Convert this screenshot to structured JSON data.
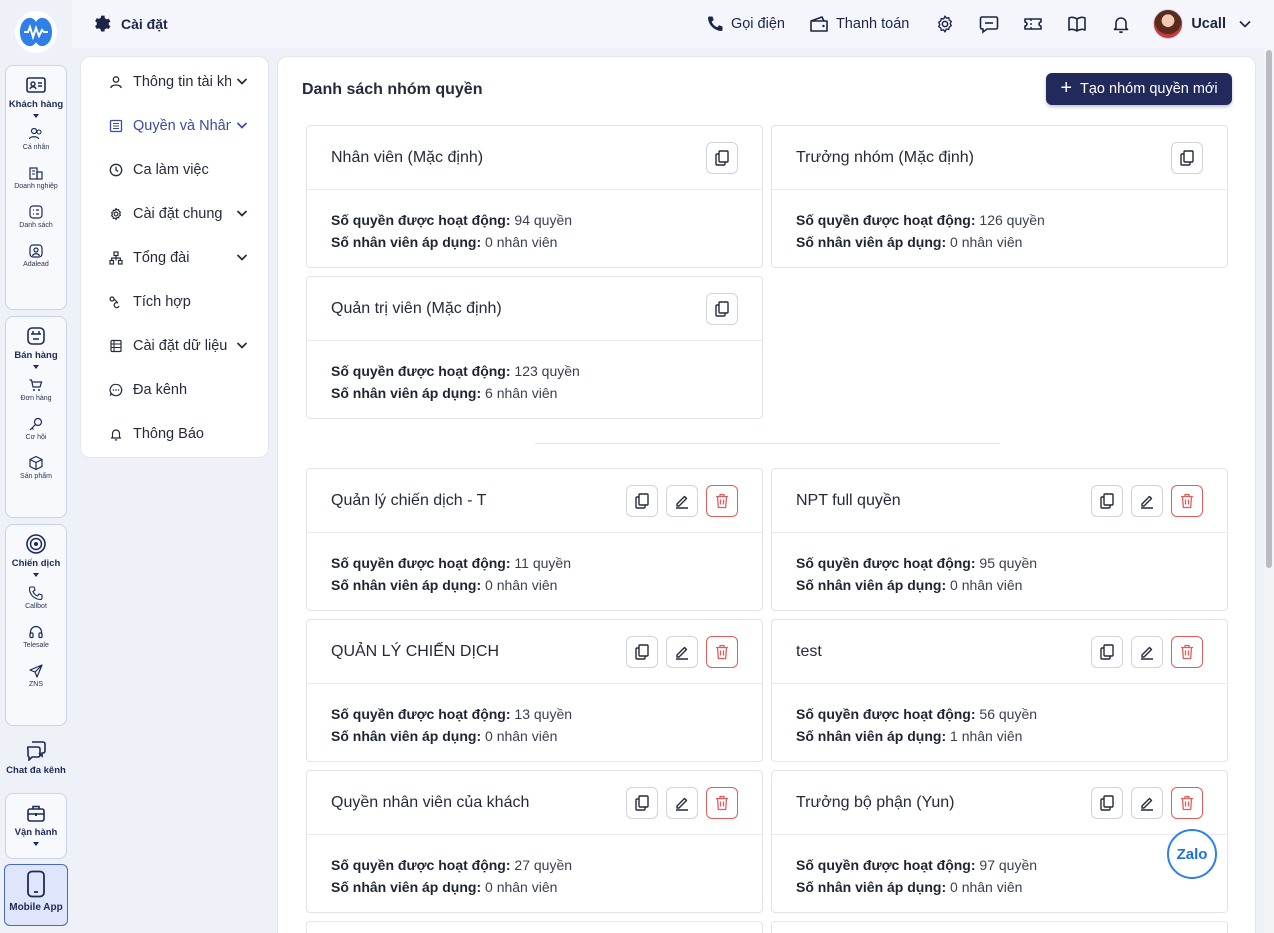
{
  "rail": {
    "groups": [
      {
        "label": "Khách hàng",
        "items": [
          "Cá nhân",
          "Doanh nghiệp",
          "Danh sách",
          "Adalead"
        ]
      },
      {
        "label": "Bán hàng",
        "items": [
          "Đơn hàng",
          "Cơ hội",
          "Sản phẩm"
        ]
      },
      {
        "label": "Chiến dịch",
        "items": [
          "Callbot",
          "Telesale",
          "ZNS"
        ]
      }
    ],
    "chat_label": "Chat đa kênh",
    "ops_label": "Vận hành",
    "mobile_label": "Mobile App"
  },
  "topbar": {
    "breadcrumb": "Cài đặt",
    "call_label": "Gọi điện",
    "pay_label": "Thanh toán",
    "user_name": "Ucall"
  },
  "menu": {
    "items": [
      {
        "label": "Thông tin tài khoản",
        "icon": "user-icon",
        "expandable": true
      },
      {
        "label": "Quyền và Nhân viên",
        "icon": "list-icon",
        "expandable": true
      },
      {
        "label": "Ca làm việc",
        "icon": "clock-icon",
        "expandable": false
      },
      {
        "label": "Cài đặt chung",
        "icon": "gear-icon",
        "expandable": true
      },
      {
        "label": "Tổng đài",
        "icon": "network-icon",
        "expandable": true
      },
      {
        "label": "Tích hợp",
        "icon": "plug-icon",
        "expandable": false
      },
      {
        "label": "Cài đặt dữ liệu",
        "icon": "database-icon",
        "expandable": true
      },
      {
        "label": "Đa kênh",
        "icon": "chat-dots-icon",
        "expandable": false
      },
      {
        "label": "Thông Báo",
        "icon": "bell-icon",
        "expandable": false
      }
    ]
  },
  "main": {
    "title": "Danh sách nhóm quyền",
    "create_label": "Tạo nhóm quyền mới",
    "perm_label": "Số quyền được hoạt động:",
    "staff_label": "Số nhân viên áp dụng:",
    "default_groups": [
      {
        "name": "Nhân viên (Mặc định)",
        "perms": "94 quyền",
        "staff": "0 nhân viên"
      },
      {
        "name": "Trưởng nhóm (Mặc định)",
        "perms": "126 quyền",
        "staff": "0 nhân viên"
      },
      {
        "name": "Quản trị viên (Mặc định)",
        "perms": "123 quyền",
        "staff": "6 nhân viên"
      }
    ],
    "custom_groups": [
      {
        "name": "Quản lý chiến dịch - T",
        "perms": "11 quyền",
        "staff": "0 nhân viên"
      },
      {
        "name": "NPT full quyền",
        "perms": "95 quyền",
        "staff": "0 nhân viên"
      },
      {
        "name": "QUẢN LÝ CHIẾN DỊCH",
        "perms": "13 quyền",
        "staff": "0 nhân viên"
      },
      {
        "name": "test",
        "perms": "56 quyền",
        "staff": "1 nhân viên"
      },
      {
        "name": "Quyền nhân viên của khách",
        "perms": "27 quyền",
        "staff": "0 nhân viên"
      },
      {
        "name": "Trưởng bộ phận (Yun)",
        "perms": "97 quyền",
        "staff": "0 nhân viên"
      }
    ]
  },
  "zalo_label": "Zalo",
  "colors": {
    "brand_dark": "#222a5c",
    "danger": "#e25c5c",
    "accent": "#2d7ff0"
  }
}
